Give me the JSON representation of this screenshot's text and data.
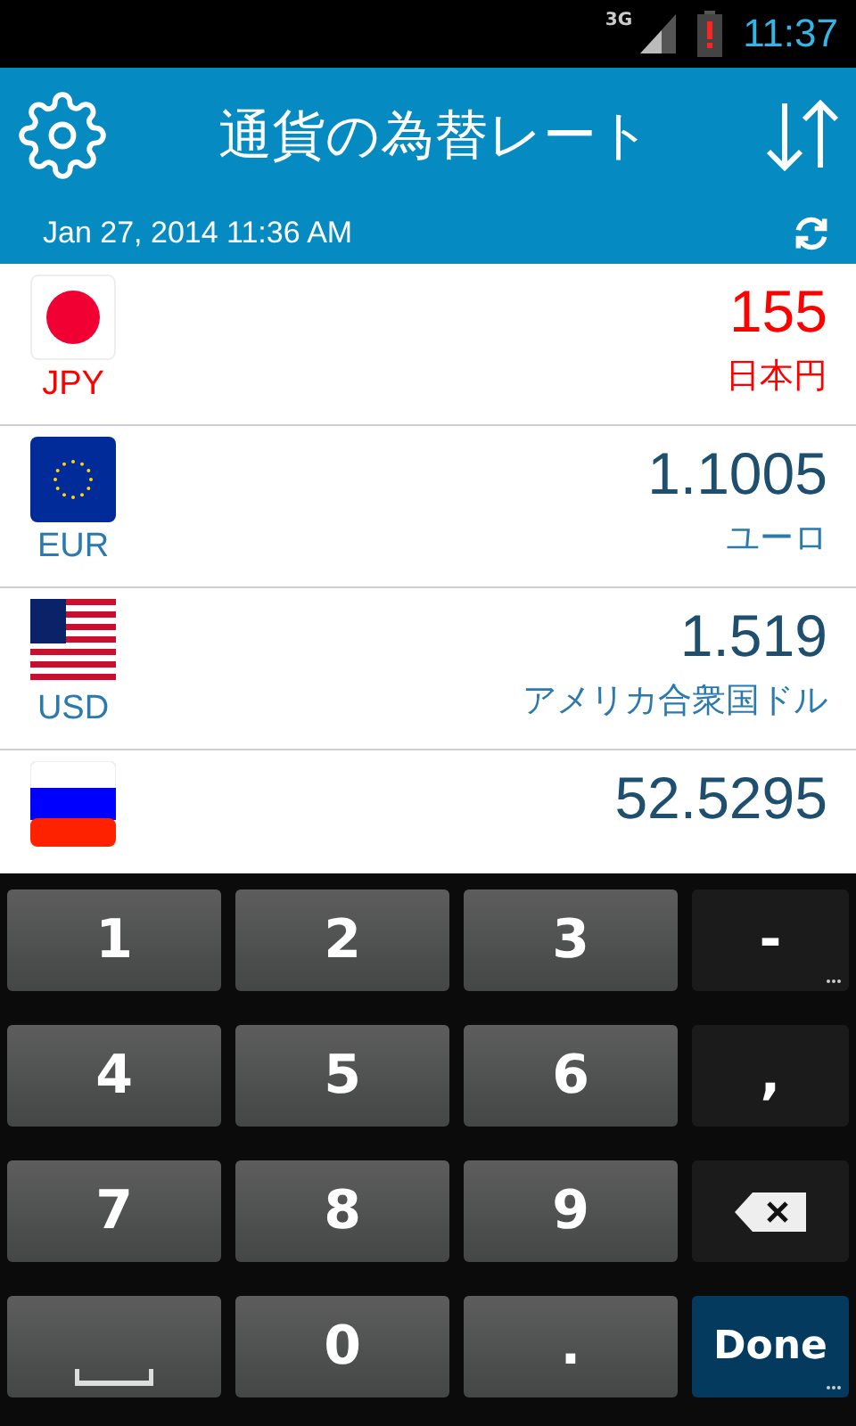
{
  "status_bar": {
    "network": "3G",
    "time": "11:37"
  },
  "header": {
    "title": "通貨の為替レート",
    "updated": "Jan 27, 2014 11:36 AM"
  },
  "currencies": [
    {
      "code": "JPY",
      "value": "155",
      "name": "日本円",
      "kind": "jp",
      "selected": true
    },
    {
      "code": "EUR",
      "value": "1.1005",
      "name": "ユーロ",
      "kind": "eu",
      "selected": false
    },
    {
      "code": "USD",
      "value": "1.519",
      "name": "アメリカ合衆国ドル",
      "kind": "us",
      "selected": false
    },
    {
      "value": "52.5295",
      "kind": "ru",
      "selected": false
    }
  ],
  "keyboard": [
    {
      "kind": "digit",
      "label": "1"
    },
    {
      "kind": "digit",
      "label": "2"
    },
    {
      "kind": "digit",
      "label": "3"
    },
    {
      "kind": "symbol",
      "label": "-",
      "more": true
    },
    {
      "kind": "digit",
      "label": "4"
    },
    {
      "kind": "digit",
      "label": "5"
    },
    {
      "kind": "digit",
      "label": "6"
    },
    {
      "kind": "symbol",
      "label": ",",
      "more": false
    },
    {
      "kind": "digit",
      "label": "7"
    },
    {
      "kind": "digit",
      "label": "8"
    },
    {
      "kind": "digit",
      "label": "9"
    },
    {
      "kind": "backspace"
    },
    {
      "kind": "space"
    },
    {
      "kind": "digit",
      "label": "0"
    },
    {
      "kind": "digit",
      "label": "."
    },
    {
      "kind": "done",
      "label": "Done",
      "more": true
    }
  ]
}
